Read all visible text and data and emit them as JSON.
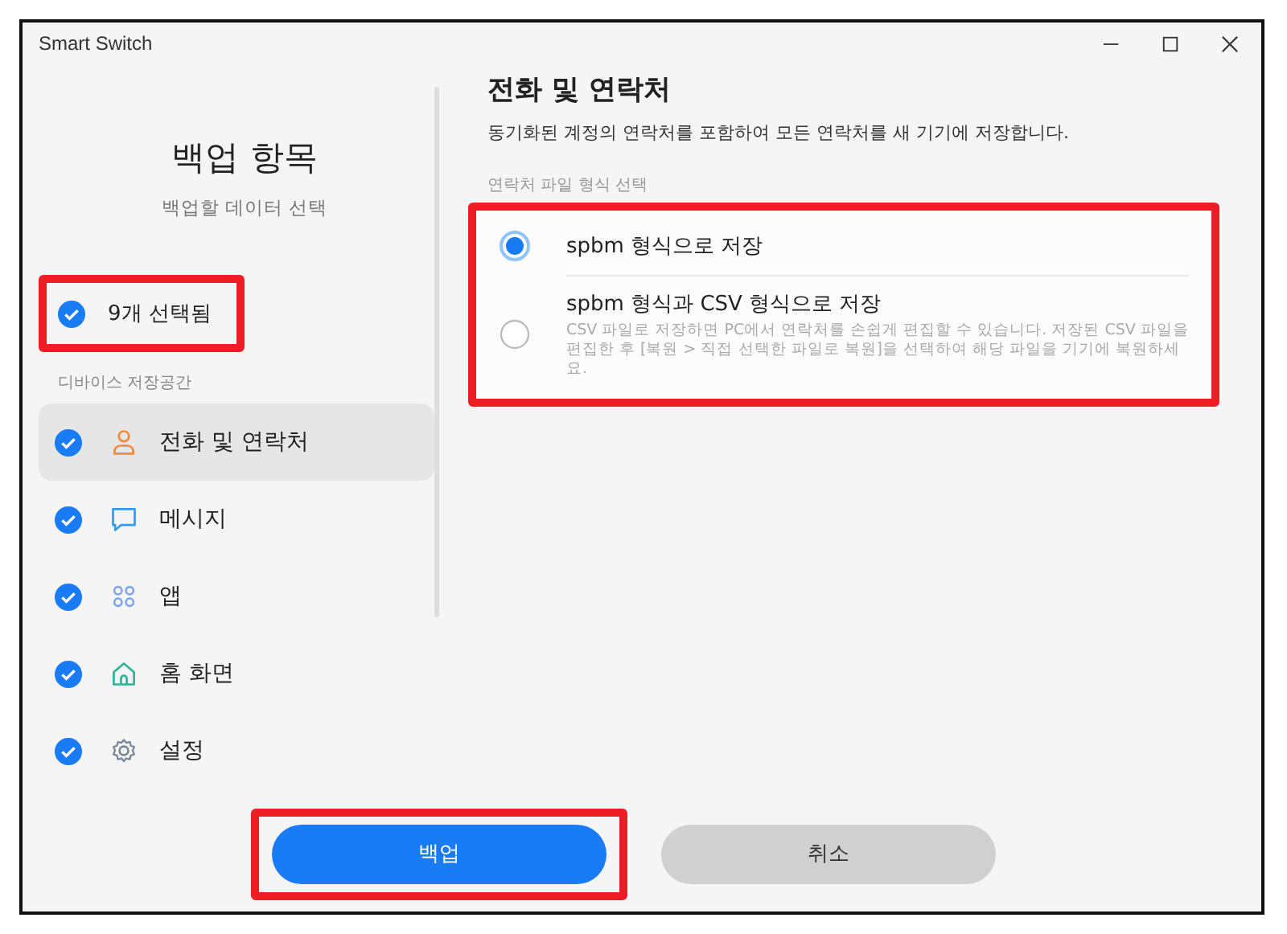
{
  "window": {
    "title": "Smart Switch"
  },
  "sidebar": {
    "title": "백업 항목",
    "subtitle": "백업할 데이터 선택",
    "selection": {
      "label": "9개 선택됨",
      "checked": true,
      "highlighted": true
    },
    "section_label": "디바이스 저장공간",
    "items": [
      {
        "label": "전화 및 연락처",
        "kind": "contacts",
        "checked": true,
        "selected": true
      },
      {
        "label": "메시지",
        "kind": "messages",
        "checked": true,
        "selected": false
      },
      {
        "label": "앱",
        "kind": "apps",
        "checked": true,
        "selected": false
      },
      {
        "label": "홈 화면",
        "kind": "home",
        "checked": true,
        "selected": false
      },
      {
        "label": "설정",
        "kind": "settings",
        "checked": true,
        "selected": false
      }
    ]
  },
  "content": {
    "title": "전화 및 연락처",
    "description": "동기화된 계정의 연락처를 포함하여 모든 연락처를 새 기기에 저장합니다.",
    "group_label": "연락처 파일 형식 선택",
    "highlighted": true,
    "options": [
      {
        "label": "spbm 형식으로 저장",
        "selected": true
      },
      {
        "label": "spbm 형식과 CSV 형식으로 저장",
        "description": "CSV 파일로 저장하면 PC에서 연락처를 손쉽게 편집할 수 있습니다. 저장된 CSV 파일을 편집한 후 [복원 > 직접 선택한 파일로 복원]을 선택하여 해당 파일을 기기에 복원하세요.",
        "selected": false
      }
    ]
  },
  "buttons": [
    {
      "label": "백업",
      "kind": "primary",
      "highlighted": true
    },
    {
      "label": "취소",
      "kind": "secondary",
      "highlighted": false
    }
  ]
}
